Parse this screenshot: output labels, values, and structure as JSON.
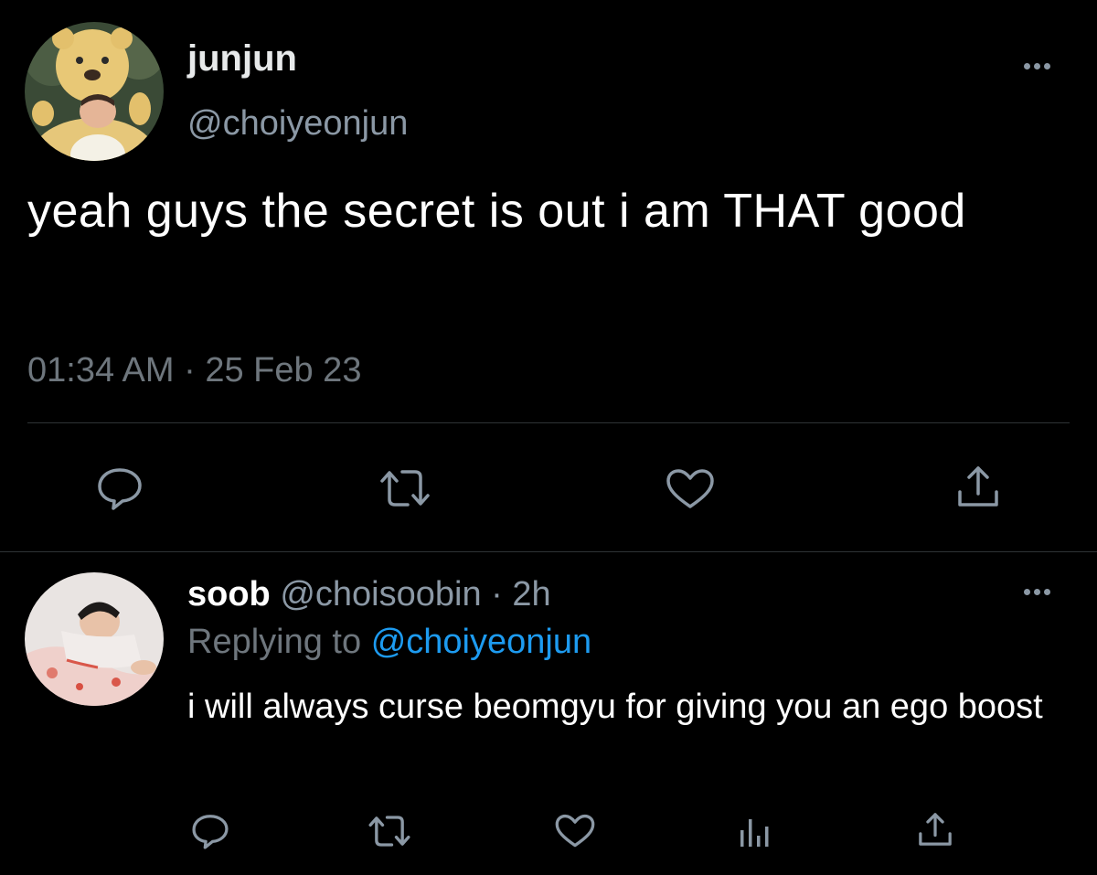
{
  "main_tweet": {
    "display_name": "junjun",
    "handle": "@choiyeonjun",
    "text": "yeah guys the secret is out i am THAT good",
    "timestamp": "01:34 AM · 25 Feb 23",
    "avatar_icon": "bear-costume-avatar",
    "actions": [
      "reply-icon",
      "retweet-icon",
      "like-icon",
      "share-icon"
    ]
  },
  "reply_tweet": {
    "display_name": "soob",
    "handle": "@choisoobin",
    "separator": "·",
    "time": "2h",
    "replying_prefix": "Replying to",
    "replying_to": "@choiyeonjun",
    "text": "i will always curse beomgyu for giving you an ego boost",
    "avatar_icon": "lying-person-avatar",
    "actions": [
      "reply-icon",
      "retweet-icon",
      "like-icon",
      "analytics-icon",
      "share-icon"
    ]
  },
  "colors": {
    "background": "#000000",
    "primary_text": "#ffffff",
    "secondary_text": "#6e767d",
    "link": "#1d9bf0",
    "divider": "#2f3336"
  }
}
